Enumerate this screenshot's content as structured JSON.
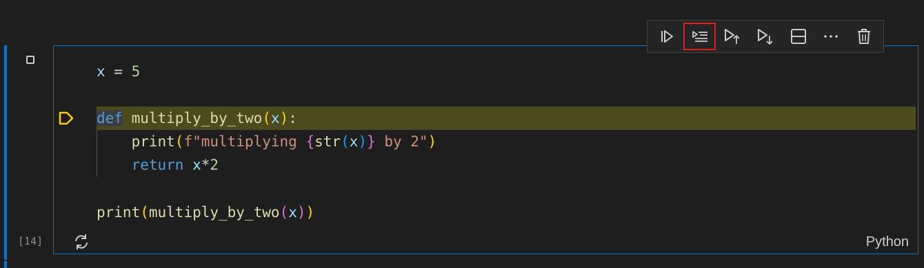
{
  "cell": {
    "execution_count": "[14]",
    "language": "Python"
  },
  "toolbar": {
    "buttons": [
      {
        "icon": "run-cell-icon"
      },
      {
        "icon": "run-by-line-icon",
        "highlighted": true
      },
      {
        "icon": "execute-above-icon"
      },
      {
        "icon": "execute-below-icon"
      },
      {
        "icon": "split-cell-icon"
      },
      {
        "icon": "more-actions-icon"
      },
      {
        "icon": "delete-cell-icon"
      }
    ]
  },
  "code": {
    "l1": {
      "x": "x",
      "eq": " = ",
      "n": "5"
    },
    "l3": {
      "def": "def",
      "sp": " ",
      "fn": "multiply_by_two",
      "op": "(",
      "arg": "x",
      "cp": ")",
      "colon": ":"
    },
    "l4": {
      "indent": "    ",
      "fn": "print",
      "op": "(",
      "fpre": "f\"multiplying ",
      "bo": "{",
      "str": "str",
      "ip": "(",
      "x": "x",
      "icp": ")",
      "bc": "}",
      "tail": " by 2\"",
      "cp": ")"
    },
    "l5": {
      "indent": "    ",
      "ret": "return",
      "sp": " ",
      "x": "x",
      "rest": "*",
      "n": "2"
    },
    "l7": {
      "fn": "print",
      "op": "(",
      "fn2": "multiply_by_two",
      "op2": "(",
      "x": "x",
      "cp2": ")",
      "cp": ")"
    }
  },
  "colors": {
    "accent": "#0078d4",
    "highlight_row": "#4b4b1e",
    "breakpoint": "#ffcc00",
    "toolbar_highlight": "#e21d1d"
  }
}
